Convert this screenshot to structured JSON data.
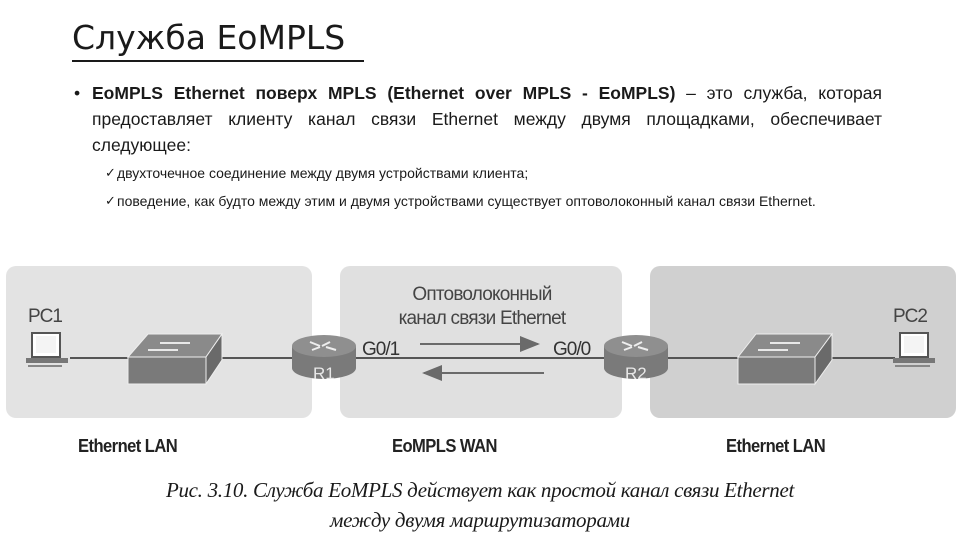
{
  "slide": {
    "title": "Служба EoMPLS",
    "bullet": {
      "marker": "•",
      "bold_text": "EoMPLS Ethernet поверх MPLS (Ethernet over MPLS - EoMPLS)",
      "rest_text": " – это служба, которая предоставляет клиенту канал связи Ethernet между двумя площадками, обеспечивает следующее:"
    },
    "sub_items": [
      {
        "marker": "✓",
        "text": "двухточечное соединение между двумя устройствами клиента;"
      },
      {
        "marker": "✓",
        "text": "поведение, как будто между этим и двумя устройствами существует оптоволоконный канал связи Ethernet."
      }
    ]
  },
  "diagram": {
    "regions": [
      {
        "name": "left-lan",
        "label": "Ethernet LAN"
      },
      {
        "name": "wan",
        "label": "EoMPLS  WAN"
      },
      {
        "name": "right-lan",
        "label": "Ethernet LAN"
      }
    ],
    "devices": {
      "pc1": "PC1",
      "pc2": "PC2",
      "r1": "R1",
      "r2": "R2"
    },
    "interfaces": {
      "r1_port": "G0/1",
      "r2_port": "G0/0"
    },
    "link_label_line1": "Оптоволоконный",
    "link_label_line2": "канал связи Ethernet",
    "colors": {
      "region_bg": "#e1e1e1",
      "region_bg_right": "#d2d2d2",
      "device_fill": "#7e7e7e",
      "link": "#555555"
    }
  },
  "caption": {
    "line1": "Рис. 3.10. Служба EoMPLS действует как простой канал связи Ethernet",
    "line2": "между двумя маршрутизаторами"
  }
}
